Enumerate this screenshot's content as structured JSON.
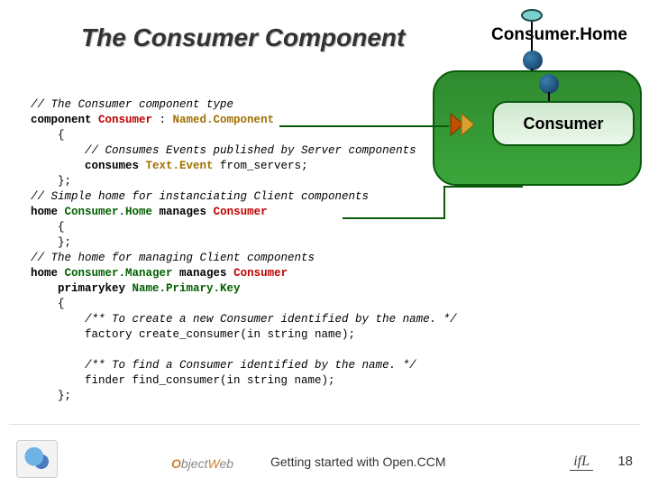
{
  "title": "The Consumer Component",
  "diagram": {
    "home_label": "Consumer.Home",
    "component_label": "Consumer"
  },
  "code": {
    "c01": "// The Consumer component type",
    "c02a": "component ",
    "c02b": "Consumer",
    "c02c": " : ",
    "c02d": "Named.Component",
    "c03": "    {",
    "c04": "        // Consumes Events published by Server components",
    "c05a": "        consumes ",
    "c05b": "Text.Event",
    "c05c": " from_servers;",
    "c06": "    };",
    "c07": "// Simple home for instanciating Client components",
    "c08a": "home ",
    "c08b": "Consumer.Home",
    "c08c": " manages ",
    "c08d": "Consumer",
    "c09": "    {",
    "c10": "    };",
    "c11": "// The home for managing Client components",
    "c12a": "home ",
    "c12b": "Consumer.Manager",
    "c12c": " manages ",
    "c12d": "Consumer",
    "c13a": "    primarykey ",
    "c13b": "Name.Primary.Key",
    "c14": "    {",
    "c15": "        /** To create a new Consumer identified by the name. */",
    "c16": "        factory create_consumer(in string name);",
    "c17": "",
    "c18": "        /** To find a Consumer identified by the name. */",
    "c19": "        finder find_consumer(in string name);",
    "c20": "    };"
  },
  "footer": {
    "objectweb": "ObjectWeb",
    "text": "Getting started with Open.CCM",
    "lifl": "ifL",
    "page": "18"
  }
}
